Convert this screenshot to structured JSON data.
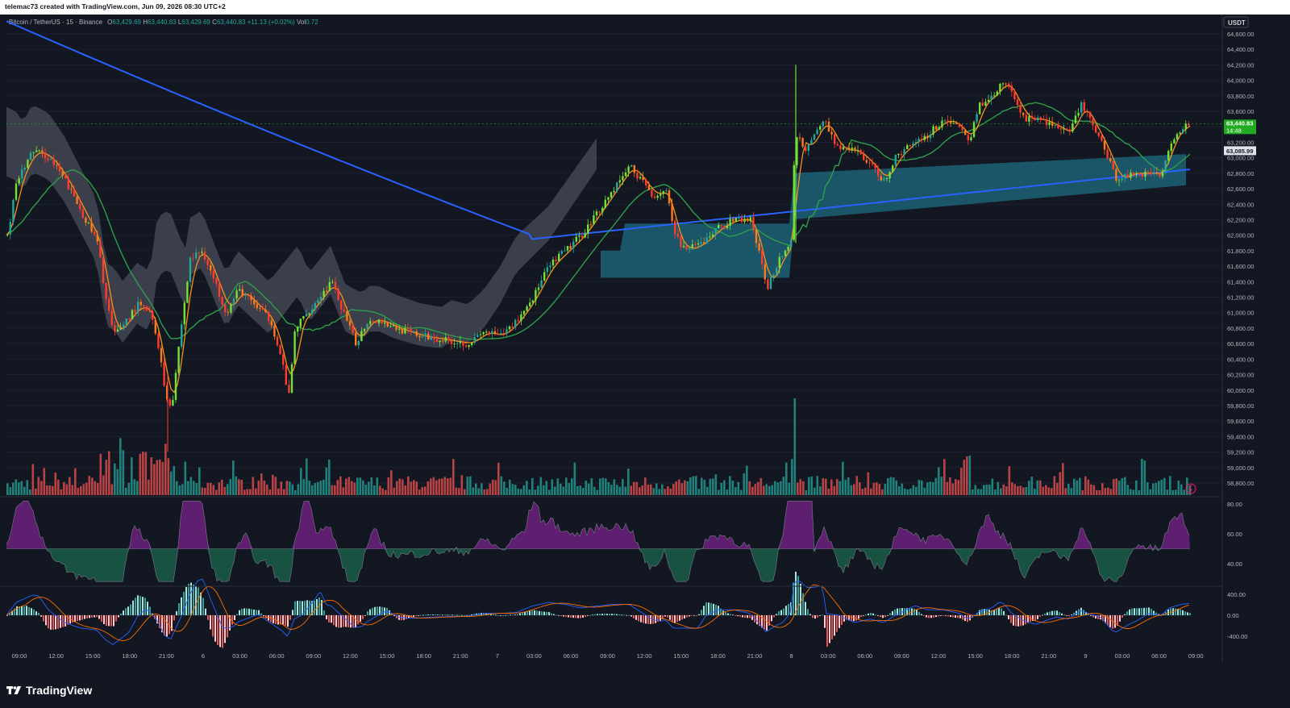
{
  "header": {
    "credit": "telemac73 created with TradingView.com, Jun 09, 2026 08:30 UTC+2"
  },
  "legend": {
    "symbol": "Bitcoin / TetherUS · 15 · Binance",
    "o_label": "O",
    "o_value": "63,429.69",
    "h_label": "H",
    "h_value": "63,440.83",
    "l_label": "L",
    "l_value": "63,429.69",
    "c_label": "C",
    "c_value": "63,440.83",
    "change": "+11.13 (+0.02%)",
    "vol_label": "Vol",
    "vol_value": "0.72"
  },
  "price_axis": {
    "currency": "USDT",
    "ticks": [
      "64,600.00",
      "64,400.00",
      "64,200.00",
      "64,000.00",
      "63,800.00",
      "63,600.00",
      "63,400.00",
      "63,200.00",
      "63,000.00",
      "62,800.00",
      "62,600.00",
      "62,400.00",
      "62,200.00",
      "62,000.00",
      "61,800.00",
      "61,600.00",
      "61,400.00",
      "61,200.00",
      "61,000.00",
      "60,800.00",
      "60,600.00",
      "60,400.00",
      "60,200.00",
      "60,000.00",
      "59,800.00",
      "59,600.00",
      "59,400.00",
      "59,200.00",
      "59,000.00",
      "58,800.00"
    ],
    "last_price": "63,440.83",
    "countdown": "14:48",
    "ma_value": "63,085.99"
  },
  "rsi_axis": {
    "ticks": [
      "80.00",
      "60.00",
      "40.00"
    ]
  },
  "macd_axis": {
    "ticks": [
      "400.00",
      "0.00",
      "-400.00"
    ]
  },
  "time_axis": {
    "ticks": [
      "09:00",
      "12:00",
      "15:00",
      "18:00",
      "21:00",
      "6",
      "03:00",
      "06:00",
      "09:00",
      "12:00",
      "15:00",
      "18:00",
      "21:00",
      "7",
      "03:00",
      "06:00",
      "09:00",
      "12:00",
      "15:00",
      "18:00",
      "21:00",
      "8",
      "03:00",
      "06:00",
      "09:00",
      "12:00",
      "15:00",
      "18:00",
      "21:00",
      "9",
      "03:00",
      "06:00",
      "09:00"
    ]
  },
  "footer": {
    "brand": "TradingView"
  },
  "colors": {
    "up": "#26a69a",
    "down": "#ef5350",
    "bright_up": "#76e03a",
    "bright_down": "#ff3b30",
    "ma_blue": "#2962ff",
    "ma_green": "#2e9e4a",
    "ema_orange": "#f7931a",
    "cloud_gray": "#4a4e5a",
    "cloud_teal": "#1d6b80",
    "rsi_purple": "#9c27b0",
    "rsi_green": "#1b7a5a"
  },
  "chart_data": {
    "type": "candlestick",
    "symbol": "Bitcoin / TetherUS",
    "timeframe": "15",
    "exchange": "Binance",
    "y_range": [
      58700,
      64700
    ],
    "key_points": [
      {
        "t": "Jun 5 09:00",
        "price": 62000
      },
      {
        "t": "Jun 5 12:00",
        "price": 63000
      },
      {
        "t": "Jun 5 20:00",
        "price": 60200
      },
      {
        "t": "Jun 5 21:00",
        "price": 59700
      },
      {
        "t": "Jun 6 00:00",
        "price": 61700
      },
      {
        "t": "Jun 6 06:00",
        "price": 60200
      },
      {
        "t": "Jun 6 09:00",
        "price": 61300
      },
      {
        "t": "Jun 6 18:00",
        "price": 60800
      },
      {
        "t": "Jun 7 00:00",
        "price": 60750
      },
      {
        "t": "Jun 7 03:00",
        "price": 61400
      },
      {
        "t": "Jun 7 09:00",
        "price": 62900
      },
      {
        "t": "Jun 7 15:00",
        "price": 61800
      },
      {
        "t": "Jun 7 21:00",
        "price": 61300
      },
      {
        "t": "Jun 8 00:00",
        "price": 63300
      },
      {
        "t": "Jun 8 06:00",
        "price": 62700
      },
      {
        "t": "Jun 8 18:00",
        "price": 64100
      },
      {
        "t": "Jun 9 03:00",
        "price": 62700
      },
      {
        "t": "Jun 9 08:30",
        "price": 63440.83
      }
    ],
    "moving_average_value": 63085.99
  }
}
